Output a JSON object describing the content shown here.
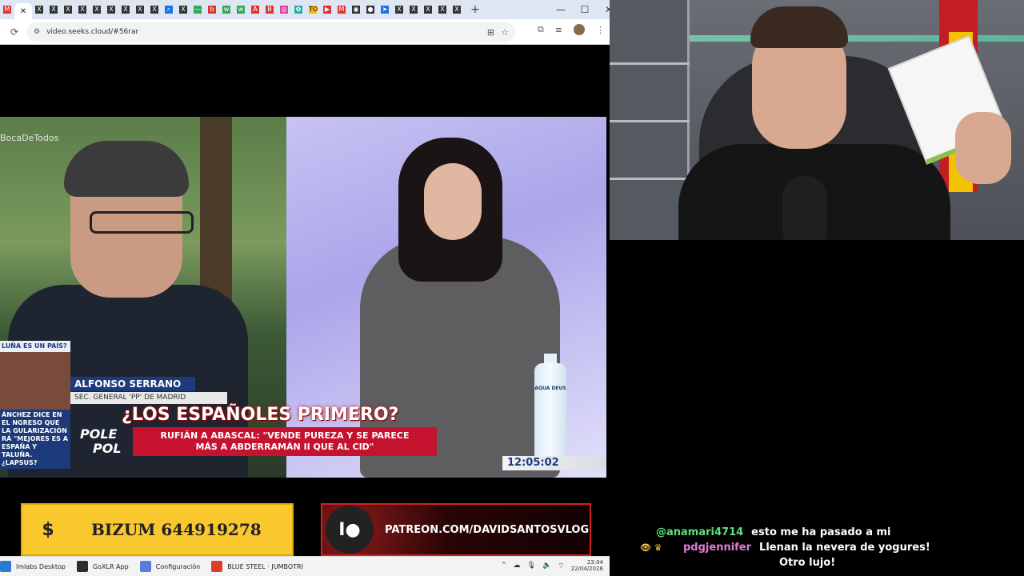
{
  "browser": {
    "tabs": [
      {
        "icon": "gmail-icon",
        "glyph": "M",
        "color": "red"
      },
      {
        "icon": "close-tab-icon",
        "glyph": "✕",
        "color": "none",
        "active": true
      },
      {
        "icon": "x-icon",
        "glyph": "X",
        "color": "dark"
      },
      {
        "icon": "x-icon",
        "glyph": "X",
        "color": "dark"
      },
      {
        "icon": "x-icon",
        "glyph": "X",
        "color": "dark"
      },
      {
        "icon": "x-icon",
        "glyph": "X",
        "color": "dark"
      },
      {
        "icon": "x-icon",
        "glyph": "X",
        "color": "dark"
      },
      {
        "icon": "x-icon",
        "glyph": "X",
        "color": "dark"
      },
      {
        "icon": "x-icon",
        "glyph": "X",
        "color": "dark"
      },
      {
        "icon": "x-icon",
        "glyph": "X",
        "color": "dark"
      },
      {
        "icon": "x-icon",
        "glyph": "X",
        "color": "dark"
      },
      {
        "icon": "search-icon",
        "glyph": "⌕",
        "color": "blue"
      },
      {
        "icon": "x-icon",
        "glyph": "X",
        "color": "dark"
      },
      {
        "icon": "dash-icon",
        "glyph": "—",
        "color": "green"
      },
      {
        "icon": "bookmark-icon",
        "glyph": "b",
        "color": "red"
      },
      {
        "icon": "app-icon",
        "glyph": "w",
        "color": "green"
      },
      {
        "icon": "app-icon",
        "glyph": "w",
        "color": "green"
      },
      {
        "icon": "pdf-icon",
        "glyph": "A",
        "color": "red"
      },
      {
        "icon": "app-icon",
        "glyph": "B",
        "color": "red"
      },
      {
        "icon": "instagram-icon",
        "glyph": "◎",
        "color": "pink"
      },
      {
        "icon": "app-icon",
        "glyph": "✿",
        "color": "teal"
      },
      {
        "icon": "app-icon",
        "glyph": "TO",
        "color": "yellow"
      },
      {
        "icon": "youtube-icon",
        "glyph": "▶",
        "color": "red"
      },
      {
        "icon": "gmail-icon",
        "glyph": "M",
        "color": "red"
      },
      {
        "icon": "app-icon",
        "glyph": "◉",
        "color": "dark"
      },
      {
        "icon": "github-icon",
        "glyph": "●",
        "color": "dark"
      },
      {
        "icon": "telegram-icon",
        "glyph": "➤",
        "color": "blue"
      },
      {
        "icon": "x-icon",
        "glyph": "X",
        "color": "dark"
      },
      {
        "icon": "x-icon",
        "glyph": "X",
        "color": "dark"
      },
      {
        "icon": "x-icon",
        "glyph": "X",
        "color": "dark"
      },
      {
        "icon": "x-icon",
        "glyph": "X",
        "color": "dark"
      },
      {
        "icon": "x-icon",
        "glyph": "X",
        "color": "dark"
      }
    ],
    "new_tab": "+",
    "window_controls": {
      "minimize": "—",
      "maximize": "☐",
      "close": "✕"
    },
    "url": "video.seeks.cloud/#56rar"
  },
  "video": {
    "watermark": "BocaDeTodos",
    "side_question": "LUÑA ES UN PAÍS?",
    "side_text": "ÁNCHEZ DICE EN EL NGRESO QUE LA GULARIZACIÓN RÁ \"MEJORES ES A ESPAÑA Y TALUÑA. ¿LAPSUS?",
    "guest_name": "ALFONSO SERRANO",
    "guest_role": "SEC. GENERAL 'PP' DE MADRID",
    "headline": "¿LOS ESPAÑOLES PRIMERO?",
    "subheadline_line1": "RUFIÁN A ABASCAL: \"VENDE PUREZA Y SE PARECE",
    "subheadline_line2": "MÁS A ABDERRAMÁN II QUE AL CID\"",
    "program_line1": "POLE",
    "program_line2": "POL",
    "clock": "12:05:02",
    "bottle_label": "AQUA DEUS"
  },
  "banners": {
    "bizum_symbol": "$",
    "bizum_text": "BIZUM 644919278",
    "patreon_text": "PATREON.COM/DAVIDSANTOSVLOG"
  },
  "taskbar": {
    "items": [
      {
        "label": "lmlabs Desktop",
        "color": "#2a7ad1"
      },
      {
        "label": "GoXLR App",
        "color": "#2d2d2d"
      },
      {
        "label": "Configuración",
        "color": "#5a7bd8"
      },
      {
        "label": "BLUE STEEL · JUMBOTRI",
        "color": "#e03a2a"
      }
    ],
    "time": "23:04",
    "date": "22/04/2026"
  },
  "chat": {
    "messages": [
      {
        "user": "@anamari4714",
        "user_color": "#5ee07c",
        "message": "esto me ha pasado a mi",
        "badges": ""
      },
      {
        "user": "pdgjennifer",
        "user_color": "#e27bd6",
        "message": "Llenan la nevera de yogures!",
        "badges": "👁 ♛"
      },
      {
        "user": "",
        "user_color": "#ffffff",
        "message": "Otro lujo!",
        "badges": ""
      }
    ]
  },
  "colors": {
    "bizum_yellow": "#f9c82e",
    "patreon_red": "#c22222",
    "news_blue": "#1d3a7a",
    "news_red": "#c4122f"
  }
}
